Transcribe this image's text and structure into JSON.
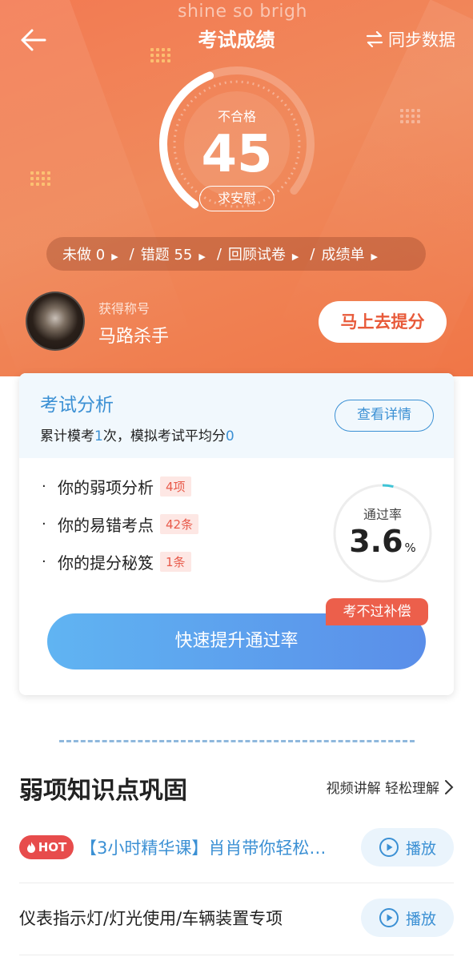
{
  "overlay_text": "shine so brigh",
  "header": {
    "title": "考试成绩",
    "sync_label": "同步数据"
  },
  "result": {
    "status": "不合格",
    "score": "45",
    "comfort_label": "求安慰",
    "gauge_fraction": 0.45
  },
  "stats": [
    {
      "label": "未做 0"
    },
    {
      "label": "错题  55"
    },
    {
      "label": "回顾试卷"
    },
    {
      "label": "成绩单"
    }
  ],
  "profile": {
    "title_label": "获得称号",
    "title_value": "马路杀手",
    "boost_label": "马上去提分"
  },
  "analysis": {
    "title": "考试分析",
    "subtitle_prefix": "累计模考",
    "exam_count": "1",
    "subtitle_mid": "次，模拟考试平均分",
    "avg_score": "0",
    "detail_label": "查看详情",
    "items": [
      {
        "label": "你的弱项分析",
        "tag": "4项"
      },
      {
        "label": "你的易错考点",
        "tag": "42条"
      },
      {
        "label": "你的提分秘笈",
        "tag": "1条"
      }
    ],
    "pass_label": "通过率",
    "pass_value": "3.6",
    "pass_unit": "%",
    "pass_fraction": 0.036,
    "compensate_label": "考不过补偿",
    "quick_label": "快速提升通过率"
  },
  "weak_section": {
    "title": "弱项知识点巩固",
    "more_label": "视频讲解 轻松理解",
    "courses": [
      {
        "hot": "HOT",
        "title": "【3小时精华课】肖肖带你轻松…",
        "play": "播放"
      },
      {
        "title": "仪表指示灯/灯光使用/车辆装置专项",
        "play": "播放"
      }
    ]
  },
  "colors": {
    "accent_blue": "#3b90d4",
    "hero_orange": "#f07a52",
    "alert_red": "#ec5f4b"
  }
}
